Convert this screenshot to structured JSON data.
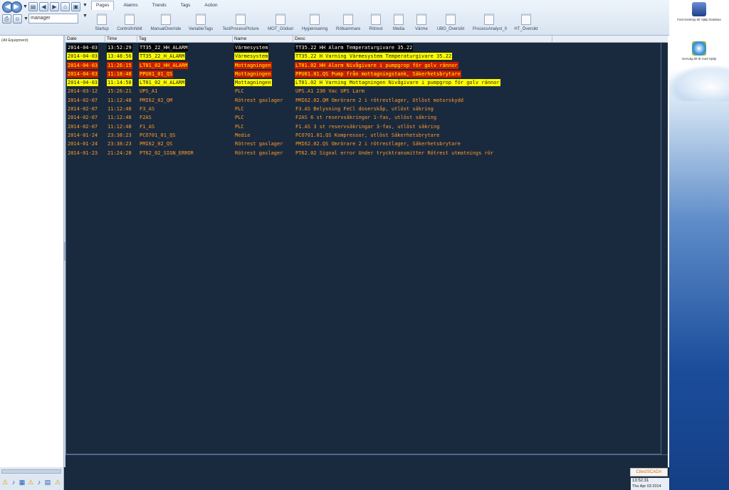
{
  "toolbar": {
    "user": "manager",
    "tabs": [
      "Pages",
      "Alarms",
      "Trends",
      "Tags",
      "Action"
    ],
    "pages": [
      "Startup",
      "ControlInhibit",
      "ManualOverride",
      "VariableTags",
      "TestProcessPicture",
      "MOT_Gödsel",
      "Hygienisering",
      "Rötkammare",
      "Rötrest",
      "Media",
      "Värme",
      "UBG_Översikt",
      "ProcessAnalyst_II",
      "HT_Översikt"
    ]
  },
  "equipment": {
    "root": "(All Equipment)"
  },
  "alarm_list": {
    "columns": [
      "Date",
      "Time",
      "Tag",
      "Name",
      "Desc"
    ],
    "rows": [
      {
        "state": "alarm",
        "date": "2014-04-03",
        "time": "13:52:29",
        "tag": "TT35_22_HH_ALARM",
        "name": "Värmesystem",
        "desc": "TT35.22 HH Alarm  Temperaturgivare 35.22"
      },
      {
        "state": "warn",
        "date": "2014-04-03",
        "time": "13:48:56",
        "tag": "TT35_22_H_ALARM",
        "name": "Värmesystem",
        "desc": "TT35.22 H Varning Värmesystem Temperaturgivare 35.22"
      },
      {
        "state": "fault",
        "date": "2014-04-03",
        "time": "11:26:15",
        "tag": "LT01_02_HH_ALARM",
        "name": "Mottagningen",
        "desc": "LT01.02 HH Alarm  Nivågivare i pumpgrop för golv rännor"
      },
      {
        "state": "fault",
        "date": "2014-04-03",
        "time": "11:18:48",
        "tag": "PPU01_01_QS",
        "name": "Mottagningen",
        "desc": "PPU01.01.QS Pump från mottagningstank, Säkerhetsbrytare"
      },
      {
        "state": "warn",
        "date": "2014-04-03",
        "time": "11:14:58",
        "tag": "LT01_02_H_ALARM",
        "name": "Mottagningen",
        "desc": "LT01.02 H Varning Mottagningen Nivågivare i pumpgrop för golv rännor"
      },
      {
        "state": "unack",
        "date": "2014-03-12",
        "time": "15:26:21",
        "tag": "UPS_A1",
        "name": "PLC",
        "desc": "UPS.A1 230 Vac UPS Larm"
      },
      {
        "state": "unack",
        "date": "2014-02-07",
        "time": "11:12:48",
        "tag": "PMI62_02_QM",
        "name": "Rötrest gaslager",
        "desc": "PMI62.02.QM Omrörare 2 i rötrestlager, Utlöst motorskydd"
      },
      {
        "state": "unack",
        "date": "2014-02-07",
        "time": "11:12:48",
        "tag": "F3_AS",
        "name": "PLC",
        "desc": "F3.AS Belysning FeCl doserskåp, utlöst säkring"
      },
      {
        "state": "unack",
        "date": "2014-02-07",
        "time": "11:12:48",
        "tag": "F2AS",
        "name": "PLC",
        "desc": "F2AS 6 st reservsäkringar 1-fas, utlöst säkring"
      },
      {
        "state": "unack",
        "date": "2014-02-07",
        "time": "11:12:48",
        "tag": "F1_AS",
        "name": "PLC",
        "desc": "F1.AS 3 st reservsäkringar 3-fas, utlöst säkring"
      },
      {
        "state": "unack",
        "date": "2014-01-24",
        "time": "23:38:23",
        "tag": "PCO701_01_QS",
        "name": "Media",
        "desc": "PCO701.01.QS Kompressor, utlöst Säkerhetsbrytare"
      },
      {
        "state": "unack",
        "date": "2014-01-24",
        "time": "23:38:23",
        "tag": "PMI62_02_QS",
        "name": "Rötrest gaslager",
        "desc": "PMI62.02.QS Omrörare 2 i rötrestlager, Säkerhetsbrytare"
      },
      {
        "state": "unack",
        "date": "2014-01-23",
        "time": "21:24:28",
        "tag": "PT62_02_SIGN_ERROR",
        "name": "Rötrest gaslager",
        "desc": "PT62.02 Signal error  Under trycktransmitter Rötrest utmatnings rör"
      }
    ]
  },
  "status": {
    "brand": "CitectSCADA",
    "time": "13:52:31",
    "date": "Thu Apr 03 2014"
  },
  "desktop": {
    "icons": [
      {
        "name": "computer-icon",
        "label": "Fast Desktop till Hjälp Databas"
      },
      {
        "name": "ie-icon",
        "label": "Genväg till IE med Hjälp"
      }
    ]
  },
  "colors": {
    "list_background": "#1a2a3e",
    "alarm_bg": "#000000",
    "warn_bg": "#ffff00",
    "fault_bg": "#cc1c00",
    "unack_text": "#ff9a2a"
  }
}
